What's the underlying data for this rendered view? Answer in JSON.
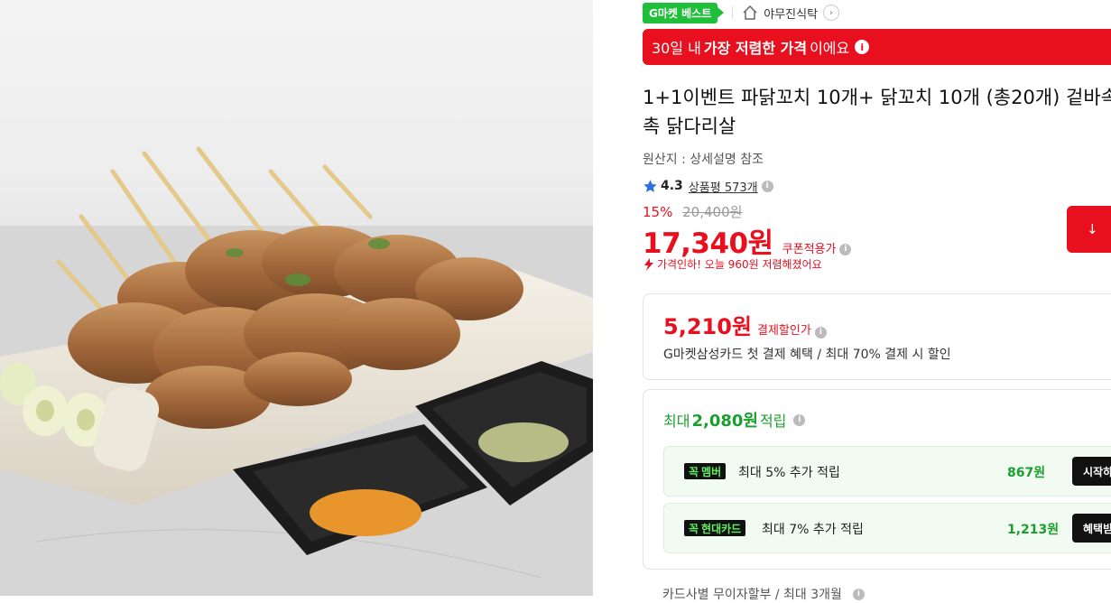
{
  "photo": {
    "alt": "grilled chicken skewers with green onion and dipping spices"
  },
  "store": {
    "badge": "G마켓 베스트",
    "name": "야무진식탁",
    "arrow": "›"
  },
  "banner": {
    "prefix": "30일 내",
    "highlight": "가장 저렴한 가격",
    "suffix": "이에요",
    "info": "i"
  },
  "product": {
    "title": "1+1이벤트 파닭꼬치 10개+ 닭꼬치 10개 (총20개) 겉바속촉 닭다리살",
    "origin": "원산지 : 상세설명 참조",
    "rating": "4.3",
    "review_label": "상품평 573개"
  },
  "price": {
    "discount": "15%",
    "original": "20,400원",
    "final": "17,340원",
    "coupon_label": "쿠폰적용가",
    "drop_notice": "가격인하! 오늘 960원 저렴해졌어요",
    "download_icon": "↓"
  },
  "card_benefit": {
    "price": "5,210원",
    "label": "결제할인가",
    "description": "G마켓삼성카드 첫 결제 혜택 / 최대 70% 결제 시 할인"
  },
  "points": {
    "prefix": "최대",
    "amount": "2,080원",
    "suffix": "적립",
    "rows": [
      {
        "badge": "멤버",
        "badge_prefix": "꼭",
        "text": "최대 5% 추가 적립",
        "amount": "867원",
        "button": "시작하"
      },
      {
        "badge": "현대카드",
        "badge_prefix": "꼭",
        "text": "최대 7% 추가 적립",
        "amount": "1,213원",
        "button": "혜택받"
      }
    ]
  },
  "installment": {
    "text": "카드사별 무이자할부 / 최대 3개월"
  },
  "colors": {
    "accent": "#e8101f",
    "green": "#1a9e2e",
    "badge_green": "#1fbf3a"
  }
}
